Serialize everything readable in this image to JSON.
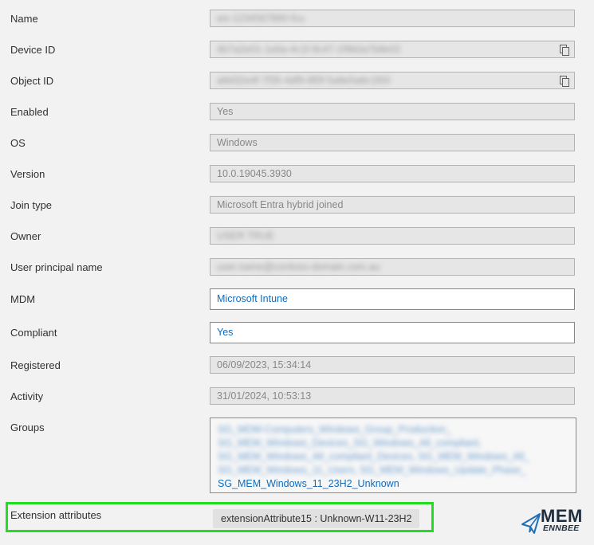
{
  "properties": [
    {
      "label": "Name",
      "value": "ws-1234567890-fcu",
      "blurred": true,
      "copy": false
    },
    {
      "label": "Device ID",
      "value": "4b7a2e01-1e6a-4c1f-9c47-1f9b0a7b8e02",
      "blurred": true,
      "copy": true
    },
    {
      "label": "Object ID",
      "value": "a8d32e4f-7f35-4df9-8f0f-5a8e5a6c1f00",
      "blurred": true,
      "copy": true
    },
    {
      "label": "Enabled",
      "value": "Yes",
      "blurred": false,
      "copy": false
    },
    {
      "label": "OS",
      "value": "Windows",
      "blurred": false,
      "copy": false
    },
    {
      "label": "Version",
      "value": "10.0.19045.3930",
      "blurred": false,
      "copy": false
    },
    {
      "label": "Join type",
      "value": "Microsoft Entra hybrid joined",
      "blurred": false,
      "copy": false
    },
    {
      "label": "Owner",
      "value": "USER TRUE",
      "blurred": true,
      "copy": false
    },
    {
      "label": "User principal name",
      "value": "user.name@contoso-domain.com.au",
      "blurred": true,
      "copy": false
    },
    {
      "label": "MDM",
      "value": "Microsoft Intune",
      "link": true
    },
    {
      "label": "Compliant",
      "value": "Yes",
      "link": true
    },
    {
      "label": "Registered",
      "value": "06/09/2023, 15:34:14",
      "blurred": false,
      "copy": false
    },
    {
      "label": "Activity",
      "value": "31/01/2024, 10:53:13",
      "blurred": false,
      "copy": false
    }
  ],
  "groups": {
    "label": "Groups",
    "items": [
      {
        "name": "SG_MDM-Computers_Windows_Group_Production_",
        "blurred": true
      },
      {
        "name": "SG_MEM_Windows_Devices_SG_Windows_All_compliant,",
        "blurred": true
      },
      {
        "name": "SG_MEM_Windows_All_compliant_Devices, SG_MEM_Windows_All_",
        "blurred": true
      },
      {
        "name": "SG_MEM_Windows_11_Users, SG_MEM_Windows_Update_Phase_",
        "blurred": true
      },
      {
        "name": "SG_MEM_Windows_11_23H2_Unknown",
        "blurred": false
      }
    ]
  },
  "extension": {
    "label": "Extension attributes",
    "value": "extensionAttribute15 : Unknown-W11-23H2"
  },
  "logo": {
    "line1": "MEM",
    "line2": "ENNBEE",
    "icon": "paper-plane-icon"
  },
  "colors": {
    "link": "#0f6cbd",
    "highlight": "#22dd22",
    "disabled_field": "#e6e6e6"
  }
}
